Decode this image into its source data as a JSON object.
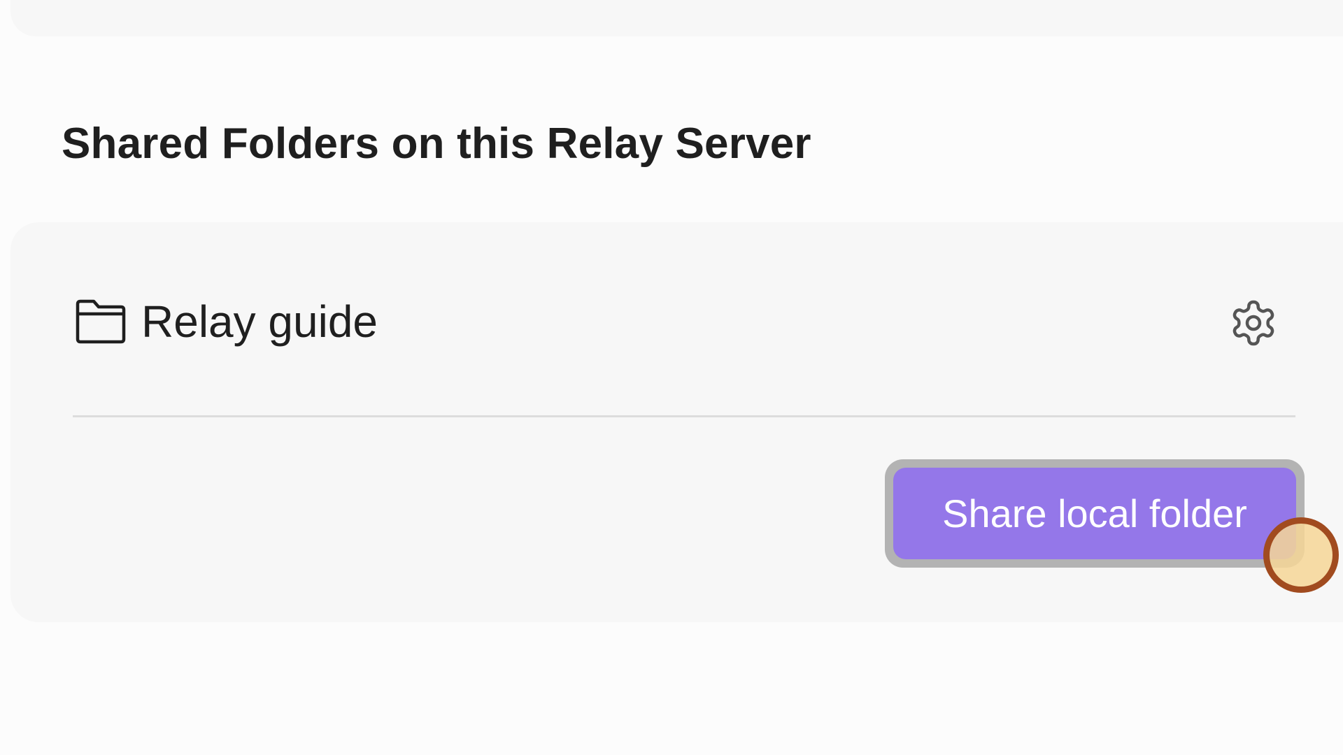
{
  "section": {
    "heading": "Shared Folders on this Relay Server"
  },
  "folders": [
    {
      "name": "Relay guide",
      "icon": "folder-icon",
      "settings_icon": "gear-icon"
    }
  ],
  "actions": {
    "share_label": "Share local folder"
  },
  "colors": {
    "accent": "#9477e9",
    "card_background": "#f7f7f7",
    "page_background": "#fcfcfc",
    "cursor_ring": "#a14b1f"
  }
}
